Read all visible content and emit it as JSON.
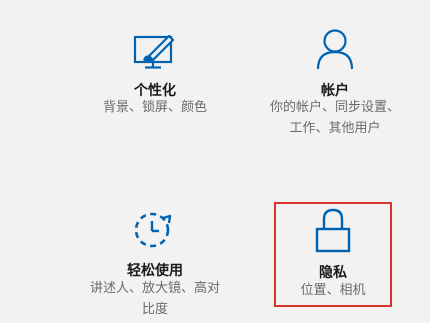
{
  "colors": {
    "background": "#f2f2f2",
    "icon_accent": "#0063b1",
    "highlight_border": "#d9342c",
    "title_text": "#1a1a1a",
    "desc_text": "#6b6b6b"
  },
  "settings": {
    "personalization": {
      "icon": "personalization-icon",
      "title": "个性化",
      "desc": [
        "背景、锁屏、颜色"
      ]
    },
    "accounts": {
      "icon": "person-icon",
      "title": "帐户",
      "desc": [
        "你的帐户、同步设置、",
        "工作、其他用户"
      ]
    },
    "ease_of_access": {
      "icon": "ease-of-access-icon",
      "title": "轻松使用",
      "desc": [
        "讲述人、放大镜、高对",
        "比度"
      ]
    },
    "privacy": {
      "icon": "lock-icon",
      "title": "隐私",
      "desc": [
        "位置、相机"
      ]
    }
  }
}
